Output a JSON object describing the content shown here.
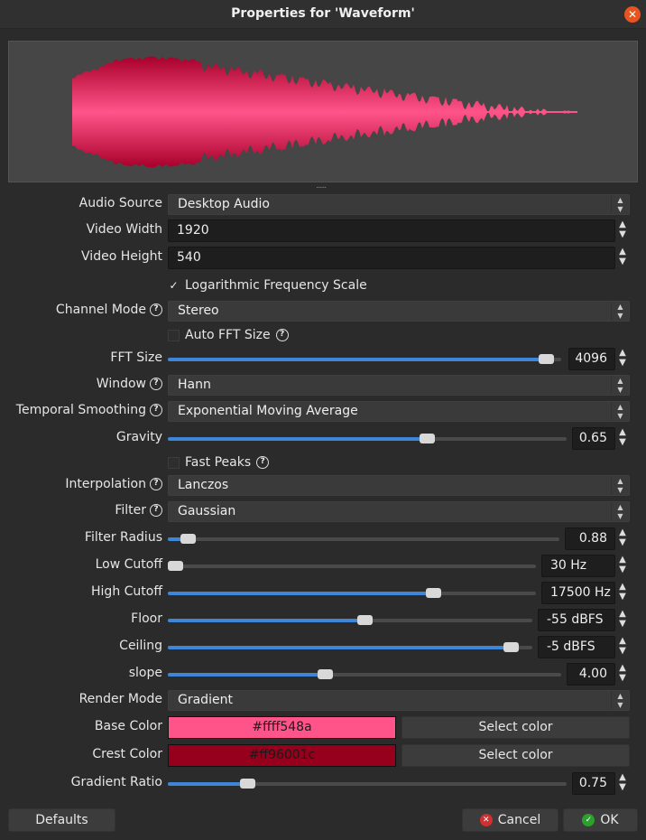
{
  "window": {
    "title": "Properties for 'Waveform'",
    "close_icon": "close-icon"
  },
  "preview": {
    "grip": "......"
  },
  "colors": {
    "accent": "#3d86d8",
    "base": "#ff548a",
    "crest": "#96001c"
  },
  "fields": {
    "audio_source": {
      "label": "Audio Source",
      "value": "Desktop Audio"
    },
    "video_width": {
      "label": "Video Width",
      "value": "1920"
    },
    "video_height": {
      "label": "Video Height",
      "value": "540"
    },
    "log_scale": {
      "label": "Logarithmic Frequency Scale",
      "checked": true
    },
    "channel_mode": {
      "label": "Channel Mode",
      "value": "Stereo"
    },
    "auto_fft": {
      "label": "Auto FFT Size",
      "checked": false
    },
    "fft_size": {
      "label": "FFT Size",
      "value": "4096",
      "level": 0.96
    },
    "window_fn": {
      "label": "Window",
      "value": "Hann"
    },
    "temporal_smoothing": {
      "label": "Temporal Smoothing",
      "value": "Exponential Moving Average"
    },
    "gravity": {
      "label": "Gravity",
      "value": "0.65",
      "level": 0.65
    },
    "fast_peaks": {
      "label": "Fast Peaks",
      "checked": false
    },
    "interpolation": {
      "label": "Interpolation",
      "value": "Lanczos"
    },
    "filter": {
      "label": "Filter",
      "value": "Gaussian"
    },
    "filter_radius": {
      "label": "Filter Radius",
      "value": "0.88",
      "level": 0.05
    },
    "low_cutoff": {
      "label": "Low Cutoff",
      "value": "30 Hz",
      "level": 0.0
    },
    "high_cutoff": {
      "label": "High Cutoff",
      "value": "17500 Hz",
      "level": 0.72
    },
    "floor": {
      "label": "Floor",
      "value": "-55 dBFS",
      "level": 0.54
    },
    "ceiling": {
      "label": "Ceiling",
      "value": "-5 dBFS",
      "level": 0.94
    },
    "slope": {
      "label": "slope",
      "value": "4.00",
      "level": 0.4
    },
    "render_mode": {
      "label": "Render Mode",
      "value": "Gradient"
    },
    "base_color": {
      "label": "Base Color",
      "value": "#ffff548a",
      "button": "Select color"
    },
    "crest_color": {
      "label": "Crest Color",
      "value": "#ff96001c",
      "button": "Select color"
    },
    "gradient_ratio": {
      "label": "Gradient Ratio",
      "value": "0.75",
      "level": 0.2
    }
  },
  "buttons": {
    "defaults": "Defaults",
    "cancel": "Cancel",
    "ok": "OK"
  }
}
